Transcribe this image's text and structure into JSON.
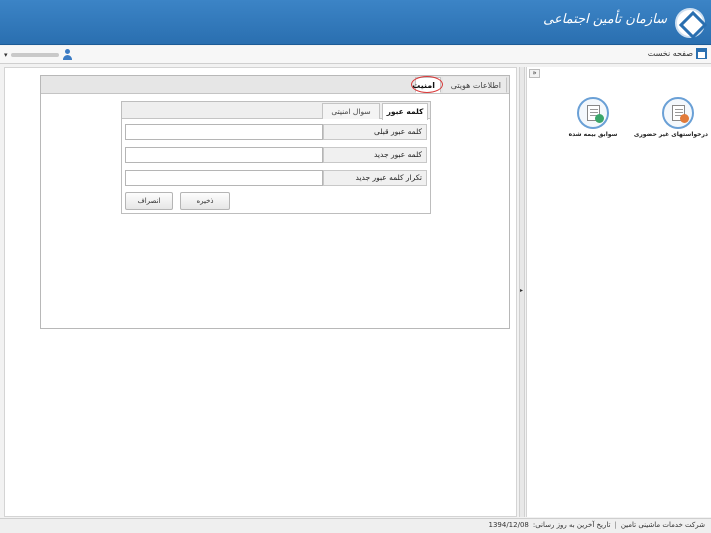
{
  "header": {
    "brand": "سازمان تأمین اجتماعی"
  },
  "nav": {
    "home_label": "صفحه نخست"
  },
  "window": {
    "tabs": [
      {
        "label": "اطلاعات هویتی"
      },
      {
        "label": "امنیت"
      }
    ],
    "inner_tabs": [
      {
        "label": "کلمه عبور"
      },
      {
        "label": "سوال امنیتی"
      }
    ],
    "fields": [
      {
        "label": "کلمه عبور قبلی",
        "value": ""
      },
      {
        "label": "کلمه عبور جدید",
        "value": ""
      },
      {
        "label": "تکرار کلمه عبور جدید",
        "value": ""
      }
    ],
    "buttons": {
      "save": "ذخیره",
      "cancel": "انصراف"
    }
  },
  "services": [
    {
      "label": "درخواستهای غیر حضوری",
      "icon": "online-request-icon"
    },
    {
      "label": "سوابق بیمه شده",
      "icon": "insurance-records-icon"
    }
  ],
  "status": {
    "company": "شرکت خدمات ماشینی تامین",
    "last_update_label": "تاریخ آخرین به روز رسانی:",
    "last_update_date": "1394/12/08"
  },
  "colors": {
    "header": "#2a6fb0",
    "highlight": "#d83a3a"
  }
}
